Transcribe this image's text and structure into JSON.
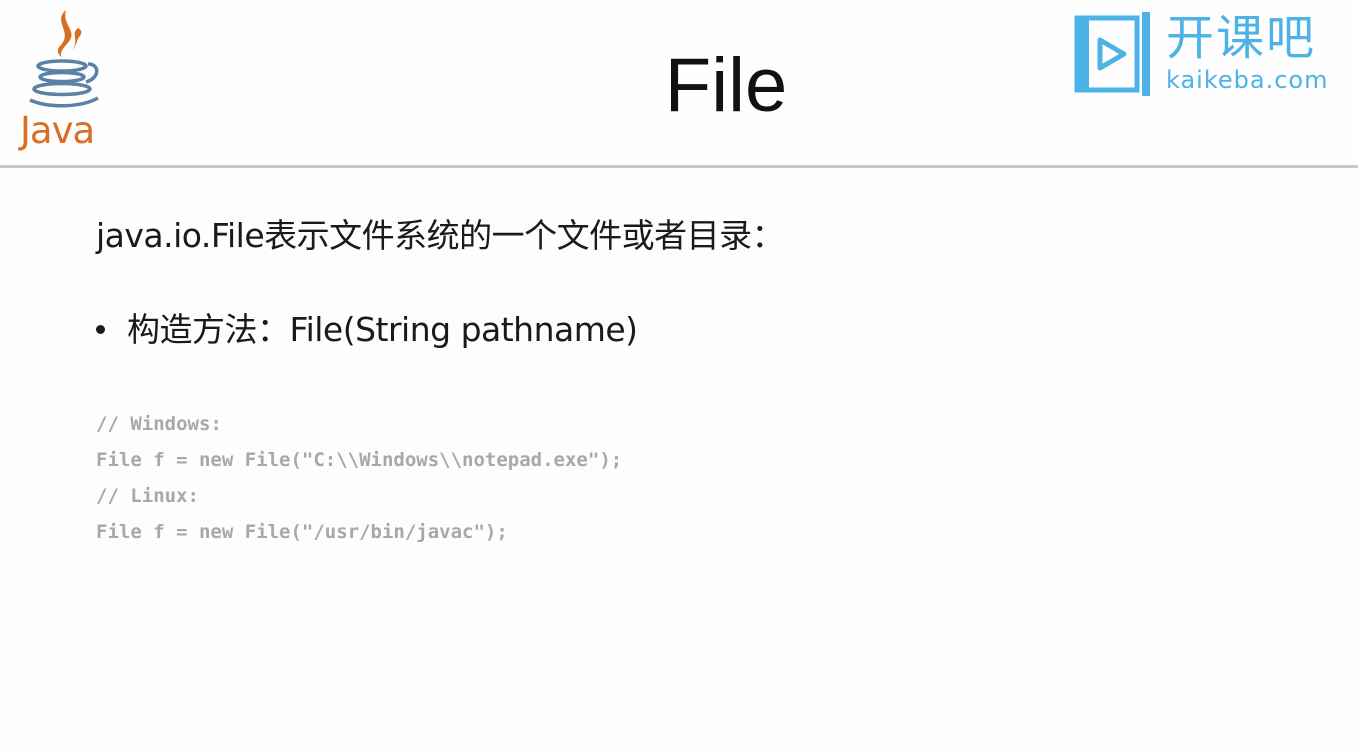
{
  "slide": {
    "title": "File",
    "logo_left": "Java",
    "brand_cn": "开课吧",
    "brand_en": "kaikeba.com",
    "intro": "java.io.File表示文件系统的一个文件或者目录：",
    "bullet": "构造方法：File(String pathname)",
    "code_lines": [
      "// Windows:",
      "File f = new File(\"C:\\\\Windows\\\\notepad.exe\");",
      "// Linux:",
      "File f = new File(\"/usr/bin/javac\");"
    ]
  },
  "colors": {
    "java_orange": "#d86f22",
    "java_blue": "#5a82a6",
    "brand_blue": "#4db2e6",
    "code_gray": "#a8a8a8"
  },
  "icons": {
    "left_logo": "java-coffee-cup-icon",
    "right_logo": "play-button-icon"
  }
}
